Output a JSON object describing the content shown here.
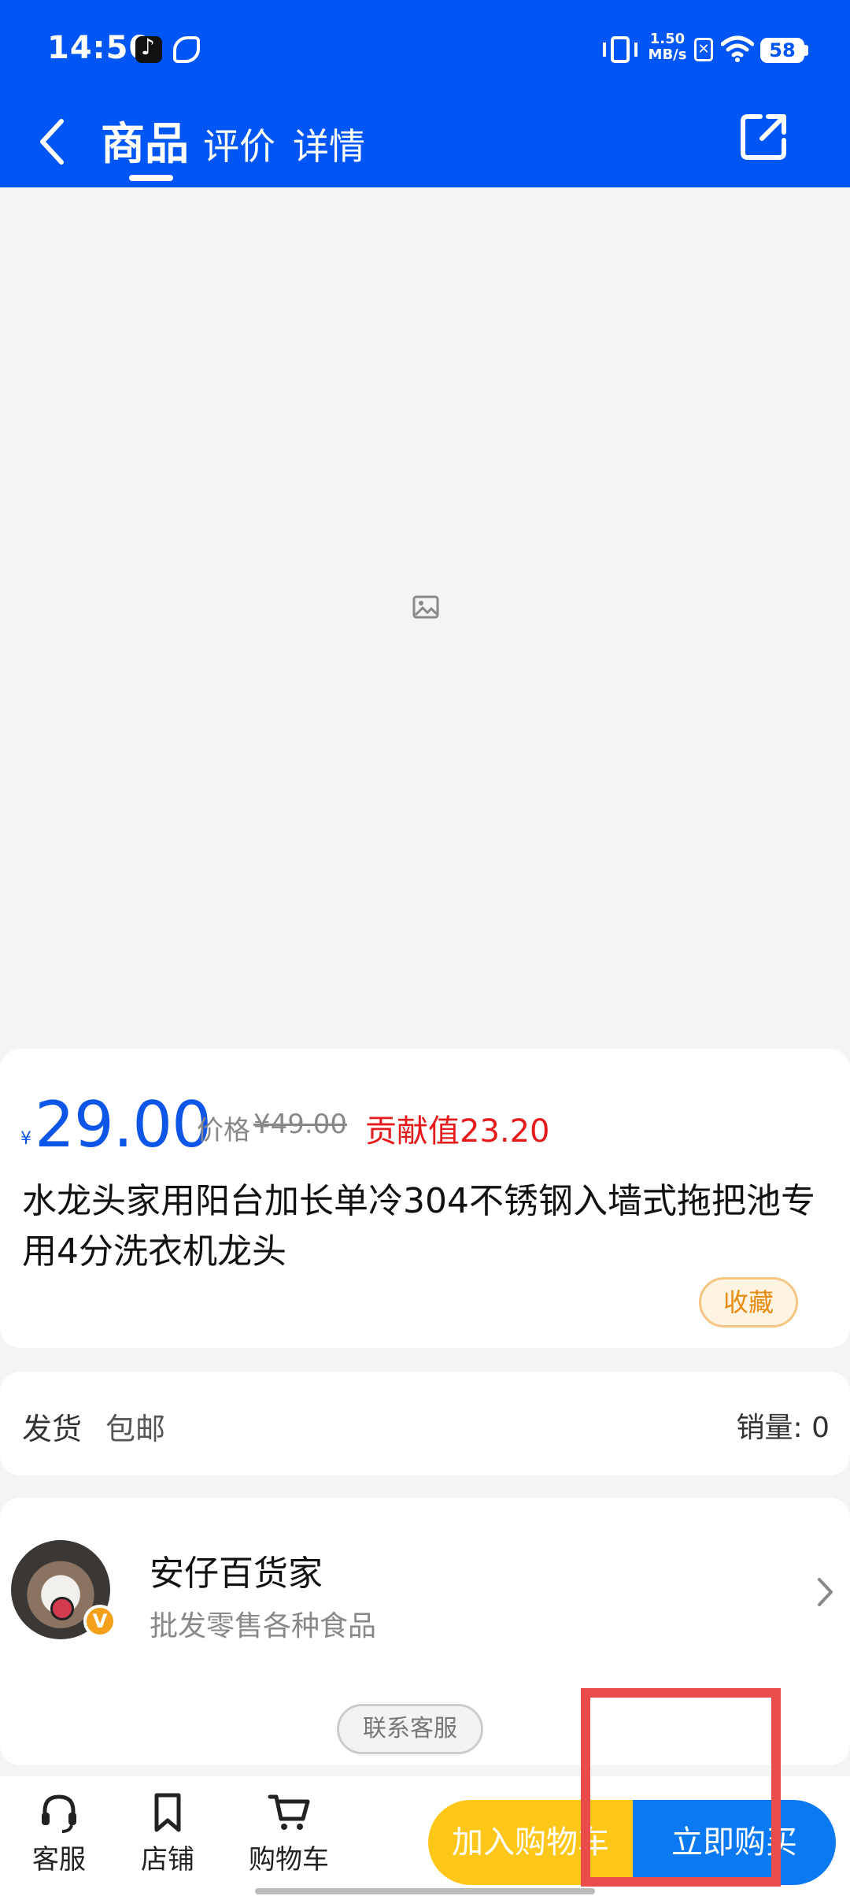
{
  "status_bar": {
    "time": "14:50",
    "net_speed_value": "1.50",
    "net_speed_unit": "MB/s",
    "battery": "58",
    "icons": [
      "tiktok-icon",
      "app-icon",
      "vibrate-icon",
      "x-icon",
      "wifi-icon",
      "battery-icon"
    ]
  },
  "nav": {
    "tabs": [
      {
        "label": "商品",
        "active": true
      },
      {
        "label": "评价",
        "active": false
      },
      {
        "label": "详情",
        "active": false
      }
    ],
    "icons": [
      "back-icon",
      "share-icon"
    ]
  },
  "product": {
    "currency_symbol": "¥",
    "price": "29.00",
    "original_price_label": "价格",
    "original_price": "¥49.00",
    "contribution": "贡献值23.20",
    "title": "水龙头家用阳台加长单冷304不锈钢入墙式拖把池专用4分洗衣机龙头",
    "favorite_label": "收藏"
  },
  "shipping": {
    "label": "发货",
    "value": "包邮",
    "sales": "销量: 0"
  },
  "shop": {
    "name": "安仔百货家",
    "description": "批发零售各种食品",
    "badge": "V",
    "contact_label": "联系客服"
  },
  "bottom_bar": {
    "service_label": "客服",
    "store_label": "店铺",
    "cart_label": "购物车",
    "add_to_cart_label": "加入购物车",
    "buy_now_label": "立即购买"
  },
  "colors": {
    "header": "#0055f5",
    "price": "#0e56e8",
    "contribution": "#e51b1b",
    "add_to_cart": "#ffc71a",
    "buy_now": "#0b79f2",
    "annotation": "#ea4b4b"
  }
}
